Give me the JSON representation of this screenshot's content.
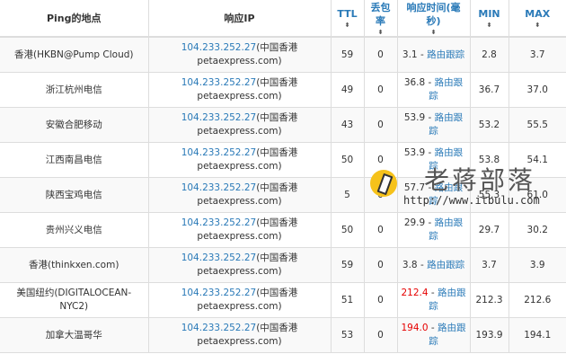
{
  "table": {
    "headers": {
      "location": "Ping的地点",
      "ip": "响应IP",
      "ttl": "TTL",
      "loss": "丢包率",
      "rt": "响应时间(毫秒)",
      "min": "MIN",
      "max": "MAX",
      "sort_glyph": "⬍"
    },
    "rows": [
      {
        "location": "香港(HKBN@Pump Cloud)",
        "ip": "104.233.252.27",
        "ip_loc": "(中国香港",
        "ip_host": "petaexpress.com)",
        "ttl": "59",
        "loss": "0",
        "rt": "3.1",
        "sep": " - ",
        "route": "路由跟踪",
        "min": "2.8",
        "max": "3.7",
        "rt_red": false
      },
      {
        "location": "浙江杭州电信",
        "ip": "104.233.252.27",
        "ip_loc": "(中国香港",
        "ip_host": "petaexpress.com)",
        "ttl": "49",
        "loss": "0",
        "rt": "36.8",
        "sep": " - ",
        "route": "路由跟踪",
        "min": "36.7",
        "max": "37.0",
        "rt_red": false
      },
      {
        "location": "安徽合肥移动",
        "ip": "104.233.252.27",
        "ip_loc": "(中国香港",
        "ip_host": "petaexpress.com)",
        "ttl": "43",
        "loss": "0",
        "rt": "53.9",
        "sep": " - ",
        "route": "路由跟踪",
        "min": "53.2",
        "max": "55.5",
        "rt_red": false
      },
      {
        "location": "江西南昌电信",
        "ip": "104.233.252.27",
        "ip_loc": "(中国香港",
        "ip_host": "petaexpress.com)",
        "ttl": "50",
        "loss": "0",
        "rt": "53.9",
        "sep": " - ",
        "route": "路由跟踪",
        "min": "53.8",
        "max": "54.1",
        "rt_red": false
      },
      {
        "location": "陕西宝鸡电信",
        "ip": "104.233.252.27",
        "ip_loc": "(中国香港",
        "ip_host": "petaexpress.com)",
        "ttl": "5",
        "loss": "0",
        "rt": "57.7",
        "sep": " - ",
        "route": "路由跟踪",
        "min": "55.3",
        "max": "61.0",
        "rt_red": false
      },
      {
        "location": "贵州兴义电信",
        "ip": "104.233.252.27",
        "ip_loc": "(中国香港",
        "ip_host": "petaexpress.com)",
        "ttl": "50",
        "loss": "0",
        "rt": "29.9",
        "sep": " - ",
        "route": "路由跟踪",
        "min": "29.7",
        "max": "30.2",
        "rt_red": false
      },
      {
        "location": "香港(thinkxen.com)",
        "ip": "104.233.252.27",
        "ip_loc": "(中国香港",
        "ip_host": "petaexpress.com)",
        "ttl": "59",
        "loss": "0",
        "rt": "3.8",
        "sep": " - ",
        "route": "路由跟踪",
        "min": "3.7",
        "max": "3.9",
        "rt_red": false
      },
      {
        "location": "美国纽约(DIGITALOCEAN-NYC2)",
        "ip": "104.233.252.27",
        "ip_loc": "(中国香港",
        "ip_host": "petaexpress.com)",
        "ttl": "51",
        "loss": "0",
        "rt": "212.4",
        "sep": " - ",
        "route": "路由跟踪",
        "min": "212.3",
        "max": "212.6",
        "rt_red": true
      },
      {
        "location": "加拿大温哥华",
        "ip": "104.233.252.27",
        "ip_loc": "(中国香港",
        "ip_host": "petaexpress.com)",
        "ttl": "53",
        "loss": "0",
        "rt": "194.0",
        "sep": " - ",
        "route": "路由跟踪",
        "min": "193.9",
        "max": "194.1",
        "rt_red": true
      }
    ]
  },
  "watermark": {
    "title": "老蒋部落",
    "url": "http://www.itbulu.com",
    "logo_color": "#f6c21a"
  },
  "colors": {
    "link": "#2a7ab8",
    "latency_high": "#e60000",
    "stripe": "#f9f9f9",
    "border": "#dddddd"
  }
}
